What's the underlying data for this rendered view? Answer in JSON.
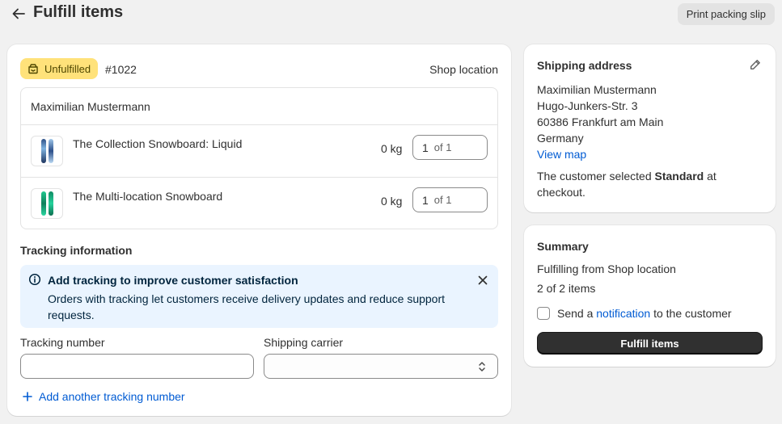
{
  "header": {
    "title": "Fulfill items",
    "print_label": "Print packing slip"
  },
  "order": {
    "status": "Unfulfilled",
    "number": "#1022",
    "location": "Shop location",
    "customer": "Maximilian Mustermann",
    "items": [
      {
        "title": "The Collection Snowboard: Liquid",
        "weight": "0 kg",
        "qty": "1",
        "of": "of 1",
        "icon": "snowboard-liquid-icon"
      },
      {
        "title": "The Multi-location Snowboard",
        "weight": "0 kg",
        "qty": "1",
        "of": "of 1",
        "icon": "snowboard-green-icon"
      }
    ]
  },
  "tracking": {
    "heading": "Tracking information",
    "banner_title": "Add tracking to improve customer satisfaction",
    "banner_body": "Orders with tracking let customers receive delivery updates and reduce support requests.",
    "number_label": "Tracking number",
    "number_value": "",
    "carrier_label": "Shipping carrier",
    "carrier_value": "",
    "add_label": "Add another tracking number"
  },
  "shipping": {
    "heading": "Shipping address",
    "lines": [
      "Maximilian Mustermann",
      "Hugo-Junkers-Str. 3",
      "60386 Frankfurt am Main",
      "Germany"
    ],
    "view_map": "View map",
    "note_prefix": "The customer selected ",
    "note_method": "Standard",
    "note_suffix": " at checkout."
  },
  "summary": {
    "heading": "Summary",
    "from": "Fulfilling from Shop location",
    "count": "2 of 2 items",
    "notify_prefix": "Send a ",
    "notify_link": "notification",
    "notify_suffix": " to the customer",
    "fulfill_label": "Fulfill items"
  },
  "colors": {
    "badge_bg": "#ffe27a",
    "banner_bg": "#eaf4ff",
    "link": "#005bd3",
    "primary_button": "#303030"
  }
}
